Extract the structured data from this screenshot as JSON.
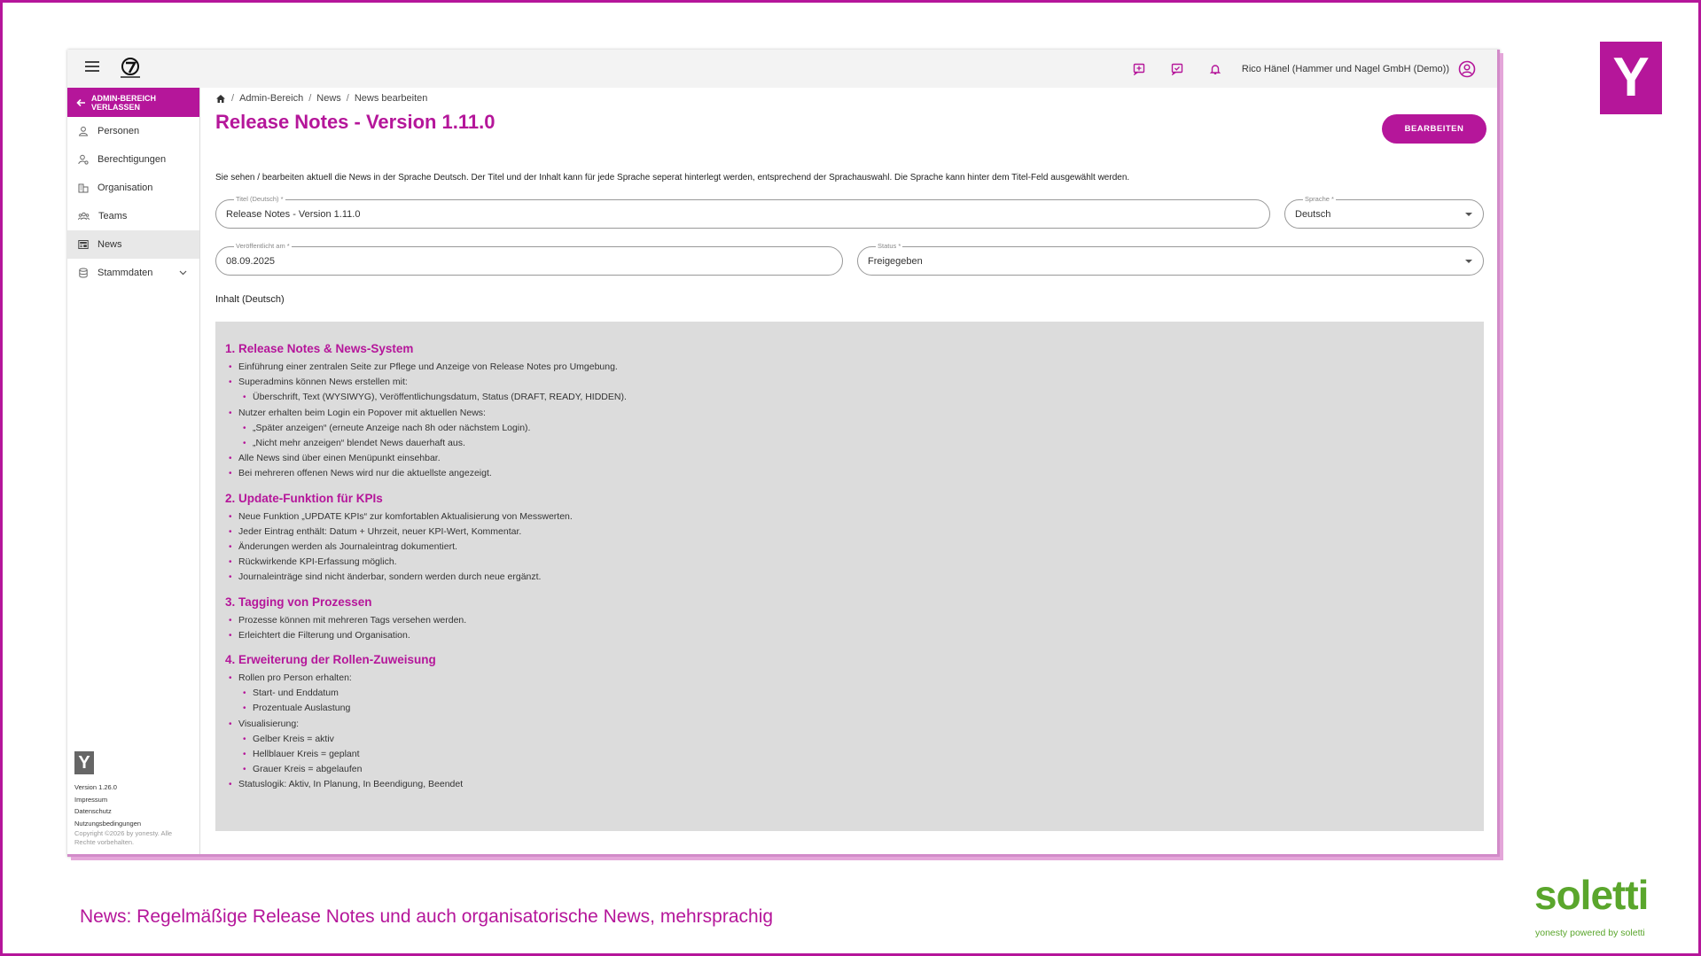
{
  "topbar": {
    "user_name": "Rico Hänel (Hammer und Nagel GmbH (Demo))",
    "icons": [
      "feedback-add-icon",
      "feedback-icon",
      "bell-icon",
      "account-circle-icon"
    ]
  },
  "sidebar": {
    "exit_admin_label": "ADMIN-BEREICH VERLASSEN",
    "items": [
      {
        "label": "Personen",
        "icon": "person-icon"
      },
      {
        "label": "Berechtigungen",
        "icon": "permissions-icon"
      },
      {
        "label": "Organisation",
        "icon": "organisation-icon"
      },
      {
        "label": "Teams",
        "icon": "teams-icon"
      },
      {
        "label": "News",
        "icon": "news-icon",
        "active": true
      },
      {
        "label": "Stammdaten",
        "icon": "database-icon",
        "expandable": true
      }
    ],
    "footer": {
      "version": "Version 1.26.0",
      "impressum": "Impressum",
      "datenschutz": "Datenschutz",
      "nutzungsbedingungen": "Nutzungsbedingungen",
      "copyright": "Copyright ©2026 by yonesty. Alle Rechte vorbehalten."
    }
  },
  "breadcrumb": [
    "Admin-Bereich",
    "News",
    "News bearbeiten"
  ],
  "page": {
    "title": "Release Notes - Version 1.11.0",
    "edit_button": "BEARBEITEN",
    "info_text": "Sie sehen / bearbeiten aktuell die News in der Sprache Deutsch. Der Titel und der Inhalt kann für jede Sprache seperat hinterlegt werden, entsprechend der Sprachauswahl. Die Sprache kann hinter dem Titel-Feld ausgewählt werden."
  },
  "form": {
    "title_label": "Titel (Deutsch) *",
    "title_value": "Release Notes - Version 1.11.0",
    "language_label": "Sprache *",
    "language_value": "Deutsch",
    "published_label": "Veröffentlicht am *",
    "published_value": "08.09.2025",
    "status_label": "Status *",
    "status_value": "Freigegeben",
    "content_label": "Inhalt (Deutsch)"
  },
  "content": {
    "s1": {
      "heading": "1. Release Notes & News-System",
      "b1": "Einführung einer zentralen Seite zur Pflege und Anzeige von Release Notes pro Umgebung.",
      "b2": "Superadmins können News erstellen mit:",
      "b2a": "Überschrift, Text (WYSIWYG), Veröffentlichungsdatum, Status (DRAFT, READY, HIDDEN).",
      "b3": "Nutzer erhalten beim Login ein Popover mit aktuellen News:",
      "b3a": "„Später anzeigen“ (erneute Anzeige nach 8h oder nächstem Login).",
      "b3b": "„Nicht mehr anzeigen“ blendet News dauerhaft aus.",
      "b4": "Alle News sind über einen Menüpunkt einsehbar.",
      "b5": "Bei mehreren offenen News wird nur die aktuellste angezeigt."
    },
    "s2": {
      "heading": "2. Update-Funktion für KPIs",
      "b1": "Neue Funktion „UPDATE KPIs“ zur komfortablen Aktualisierung von Messwerten.",
      "b2": "Jeder Eintrag enthält: Datum + Uhrzeit, neuer KPI-Wert, Kommentar.",
      "b3": "Änderungen werden als Journaleintrag dokumentiert.",
      "b4": "Rückwirkende KPI-Erfassung möglich.",
      "b5": "Journaleinträge sind nicht änderbar, sondern werden durch neue ergänzt."
    },
    "s3": {
      "heading": "3. Tagging von Prozessen",
      "b1": "Prozesse können mit mehreren Tags versehen werden.",
      "b2": "Erleichtert die Filterung und Organisation."
    },
    "s4": {
      "heading": "4. Erweiterung der Rollen-Zuweisung",
      "b1": "Rollen pro Person erhalten:",
      "b1a": "Start- und Enddatum",
      "b1b": "Prozentuale Auslastung",
      "b2": "Visualisierung:",
      "b2a": "Gelber Kreis = aktiv",
      "b2b": "Hellblauer Kreis = geplant",
      "b2c": "Grauer Kreis = abgelaufen",
      "b3": "Statuslogik: Aktiv, In Planung, In Beendigung, Beendet"
    }
  },
  "slide": {
    "caption": "News: Regelmäßige Release Notes und auch organisatorische News, mehrsprachig",
    "brand": "soletti",
    "brand_sub": "yonesty powered by soletti",
    "y_logo": "Y",
    "accent_color": "#b5169a",
    "brand_color": "#5aa62c"
  }
}
